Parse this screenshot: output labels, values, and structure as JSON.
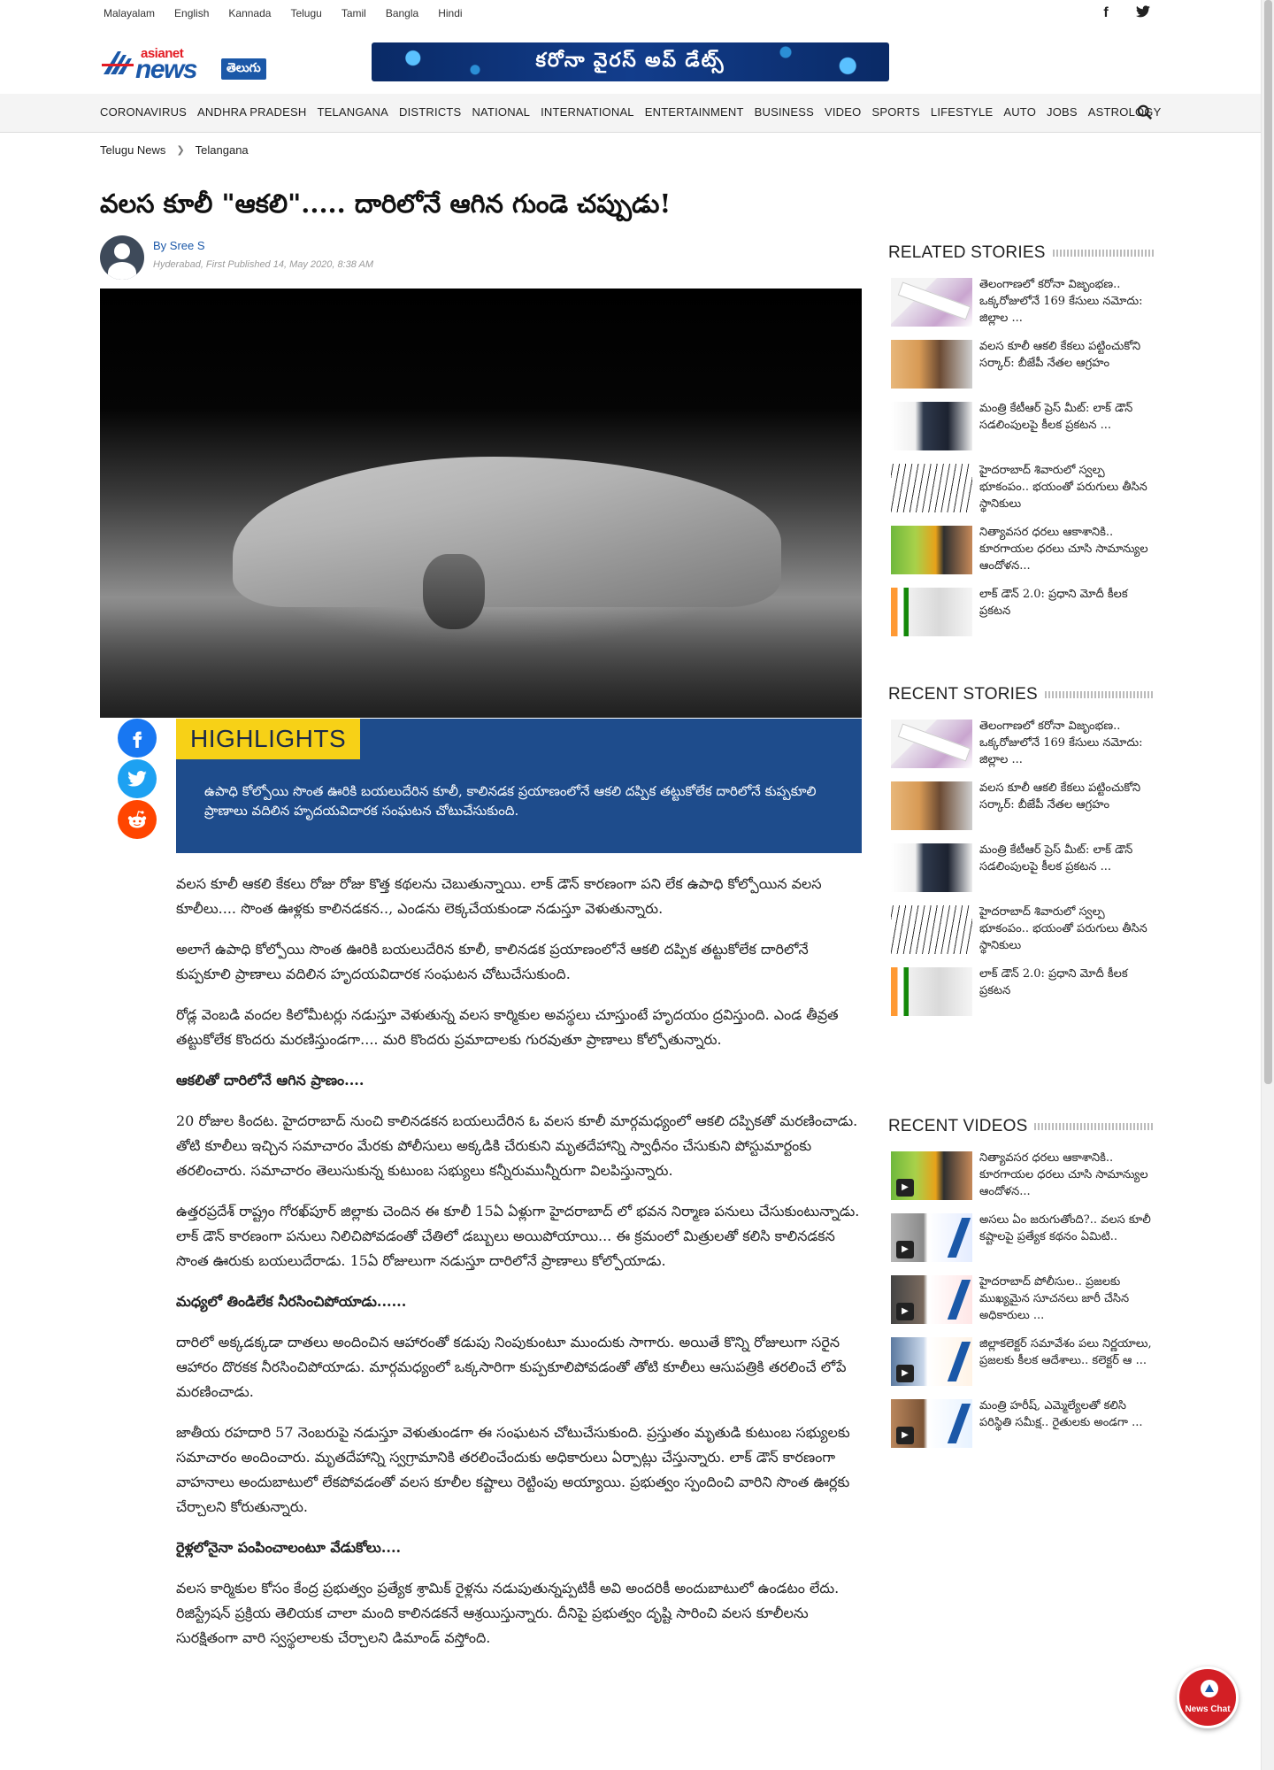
{
  "languages": [
    "Malayalam",
    "English",
    "Kannada",
    "Telugu",
    "Tamil",
    "Bangla",
    "Hindi"
  ],
  "social_top": {
    "facebook": "f",
    "twitter": "t"
  },
  "logo": {
    "line1": "asianet",
    "line2": "news",
    "badge": "తెలుగు"
  },
  "corona_banner": "కరోనా వైరస్ అప్ డేట్స్",
  "nav": [
    "CORONAVIRUS",
    "ANDHRA PRADESH",
    "TELANGANA",
    "DISTRICTS",
    "NATIONAL",
    "INTERNATIONAL",
    "ENTERTAINMENT",
    "BUSINESS",
    "VIDEO",
    "SPORTS",
    "LIFESTYLE",
    "AUTO",
    "JOBS",
    "ASTROLOGY"
  ],
  "breadcrumb": {
    "home": "Telugu News",
    "section": "Telangana"
  },
  "article": {
    "title": "వలస కూలీ \"ఆకలి\"..... దారిలోనే ఆగిన గుండె చప్పుడు!",
    "author": "By Sree S",
    "meta": "Hyderabad, First Published 14, May 2020, 8:38 AM",
    "highlights_label": "HIGHLIGHTS",
    "highlights_text": "ఉపాధి కోల్పోయి సొంత ఊరికి బయలుదేరిన కూలీ, కాలినడక ప్రయాణంలోనే ఆకలి దప్పిక తట్టుకోలేక దారిలోనే కుప్పకూలి ప్రాణాలు వదిలిన హృదయవిదారక సంఘటన చోటుచేసుకుంది.",
    "paragraphs": [
      {
        "text": "వలస కూలీ ఆకలి కేకలు రోజు రోజు కొత్త కథలను చెబుతున్నాయి. లాక్ డౌన్ కారణంగా పని లేక ఉపాధి కోల్పోయిన వలస కూలీలు.... సొంత ఊళ్లకు కాలినడకన.., ఎండను లెక్కచేయకుండా నడుస్తూ వెళుతున్నారు.",
        "sub": false
      },
      {
        "text": "అలాగే ఉపాధి కోల్పోయి సొంత ఊరికి బయలుదేరిన కూలీ, కాలినడక ప్రయాణంలోనే ఆకలి దప్పిక తట్టుకోలేక దారిలోనే కుప్పకూలి ప్రాణాలు వదిలిన హృదయవిదారక సంఘటన చోటుచేసుకుంది.",
        "sub": false
      },
      {
        "text": "రోడ్ల వెంబడి వందల కిలోమీటర్లు నడుస్తూ వెళుతున్న వలస కార్మికుల అవస్థలు చూస్తుంటే హృదయం ద్రవిస్తుంది. ఎండ తీవ్రత తట్టుకోలేక కొందరు మరణిస్తుండగా.... మరి కొందరు ప్రమాదాలకు గురవుతూ ప్రాణాలు కోల్పోతున్నారు.",
        "sub": false
      },
      {
        "text": "ఆకలితో దారిలోనే ఆగిన ప్రాణం....",
        "sub": true
      },
      {
        "text": "20 రోజుల కిందట. హైదరాబాద్ నుంచి కాలినడకన బయలుదేరిన ఓ వలస కూలీ మార్గమధ్యంలో ఆకలి దప్పికతో మరణించాడు. తోటి కూలీలు ఇచ్చిన సమాచారం మేరకు పోలీసులు అక్కడికి చేరుకుని మృతదేహాన్ని స్వాధీనం చేసుకుని పోస్టుమార్టంకు తరలించారు. సమాచారం తెలుసుకున్న కుటుంబ సభ్యులు కన్నీరుమున్నీరుగా విలపిస్తున్నారు.",
        "sub": false
      },
      {
        "text": "ఉత్తరప్రదేశ్ రాష్ట్రం గోరఖ్‌పూర్ జిల్లాకు చెందిన ఈ కూలీ 15ఏ ఏళ్లుగా హైదరాబాద్ లో భవన నిర్మాణ పనులు చేసుకుంటున్నాడు. లాక్ డౌన్ కారణంగా పనులు నిలిచిపోవడంతో చేతిలో డబ్బులు అయిపోయాయి... ఈ క్రమంలో మిత్రులతో కలిసి కాలినడకన సొంత ఊరుకు బయలుదేరాడు. 15ఏ రోజులుగా నడుస్తూ దారిలోనే ప్రాణాలు కోల్పోయాడు.",
        "sub": false
      },
      {
        "text": "మధ్యలో తిండిలేక నీరసించిపోయాడు......",
        "sub": true
      },
      {
        "text": "దారిలో అక్కడక్కడా దాతలు అందించిన ఆహారంతో కడుపు నింపుకుంటూ ముందుకు సాగారు. అయితే కొన్ని రోజులుగా సరైన ఆహారం దొరకక నీరసించిపోయాడు. మార్గమధ్యంలో ఒక్కసారిగా కుప్పకూలిపోవడంతో తోటి కూలీలు ఆసుపత్రికి తరలించే లోపే మరణించాడు.",
        "sub": false
      },
      {
        "text": "జాతీయ రహదారి 57 నెంబరుపై నడుస్తూ వెళుతుండగా ఈ సంఘటన చోటుచేసుకుంది. ప్రస్తుతం మృతుడి కుటుంబ సభ్యులకు సమాచారం అందించారు. మృతదేహాన్ని స్వగ్రామానికి తరలించేందుకు అధికారులు ఏర్పాట్లు చేస్తున్నారు. లాక్ డౌన్ కారణంగా వాహనాలు అందుబాటులో లేకపోవడంతో వలస కూలీల కష్టాలు రెట్టింపు అయ్యాయి. ప్రభుత్వం స్పందించి వారిని సొంత ఊర్లకు చేర్చాలని కోరుతున్నారు.",
        "sub": false
      },
      {
        "text": "రైళ్లలోనైనా పంపించాలంటూ వేడుకోలు....",
        "sub": true
      },
      {
        "text": "వలస కార్మికుల కోసం కేంద్ర ప్రభుత్వం ప్రత్యేక శ్రామిక్ రైళ్లను నడుపుతున్నప్పటికీ అవి అందరికీ అందుబాటులో ఉండటం లేదు. రిజిస్ట్రేషన్ ప్రక్రియ తెలియక చాలా మంది కాలినడకనే ఆశ్రయిస్తున్నారు. దీనిపై ప్రభుత్వం దృష్టి సారించి వలస కూలీలను సురక్షితంగా వారి స్వస్థలాలకు చేర్చాలని డిమాండ్ వస్తోంది.",
        "sub": false
      }
    ]
  },
  "related_stories": {
    "title": "RELATED STORIES",
    "items": [
      {
        "text": "తెలంగాణలో కరోనా విజృంభణ.. ఒక్కరోజులోనే 169 కేసులు నమోదు: జిల్లాల ...",
        "thumb": "lab"
      },
      {
        "text": "వలస కూలీ ఆకలి కేకలు పట్టించుకోని సర్కార్: బీజేపీ నేతల ఆగ్రహం",
        "thumb": "man"
      },
      {
        "text": "మంత్రి కేటీఆర్ ప్రెస్ మీట్: లాక్ డౌన్ సడలింపులపై కీలక ప్రకటన ...",
        "thumb": "press"
      },
      {
        "text": "హైదరాబాద్ శివారులో స్వల్ప భూకంపం.. భయంతో పరుగులు తీసిన స్థానికులు",
        "thumb": "seis"
      },
      {
        "text": "నిత్యావసర ధరలు ఆకాశానికి.. కూరగాయల ధరలు చూసి సామాన్యుల ఆందోళన...",
        "thumb": "veg"
      },
      {
        "text": "లాక్ డౌన్ 2.0: ప్రధాని మోదీ కీలక ప్రకటన",
        "thumb": "modi"
      }
    ]
  },
  "recent_stories": {
    "title": "RECENT STORIES",
    "items": [
      {
        "text": "తెలంగాణలో కరోనా విజృంభణ.. ఒక్కరోజులోనే 169 కేసులు నమోదు: జిల్లాల ...",
        "thumb": "lab"
      },
      {
        "text": "వలస కూలీ ఆకలి కేకలు పట్టించుకోని సర్కార్: బీజేపీ నేతల ఆగ్రహం",
        "thumb": "man"
      },
      {
        "text": "మంత్రి కేటీఆర్ ప్రెస్ మీట్: లాక్ డౌన్ సడలింపులపై కీలక ప్రకటన ...",
        "thumb": "press"
      },
      {
        "text": "హైదరాబాద్ శివారులో స్వల్ప భూకంపం.. భయంతో పరుగులు తీసిన స్థానికులు",
        "thumb": "seis"
      },
      {
        "text": "లాక్ డౌన్ 2.0: ప్రధాని మోదీ కీలక ప్రకటన",
        "thumb": "modi"
      }
    ]
  },
  "recent_videos": {
    "title": "RECENT VIDEOS",
    "items": [
      {
        "text": "నిత్యావసర ధరలు ఆకాశానికి.. కూరగాయల ధరలు చూసి సామాన్యుల ఆందోళన...",
        "thumb": "veg"
      },
      {
        "text": "అసలు ఏం జరుగుతోంది?.. వలస కూలీ కష్టాలపై ప్రత్యేక కథనం ఏమిటి..",
        "thumb": "v1"
      },
      {
        "text": "హైదరాబాద్ పోలీసుల.. ప్రజలకు ముఖ్యమైన సూచనలు జారీ చేసిన అధికారులు ...",
        "thumb": "v2"
      },
      {
        "text": "జిల్లాకలెక్టర్ సమావేశం పలు నిర్ణయాలు, ప్రజలకు కీలక ఆదేశాలు.. కలెక్టర్ ఆ ...",
        "thumb": "v3"
      },
      {
        "text": "మంత్రి హరీష్, ఎమ్మెల్యేలతో కలిసి పరిస్థితి సమీక్ష.. రైతులకు అండగా ...",
        "thumb": "v4"
      }
    ]
  },
  "news_chat": "News Chat"
}
